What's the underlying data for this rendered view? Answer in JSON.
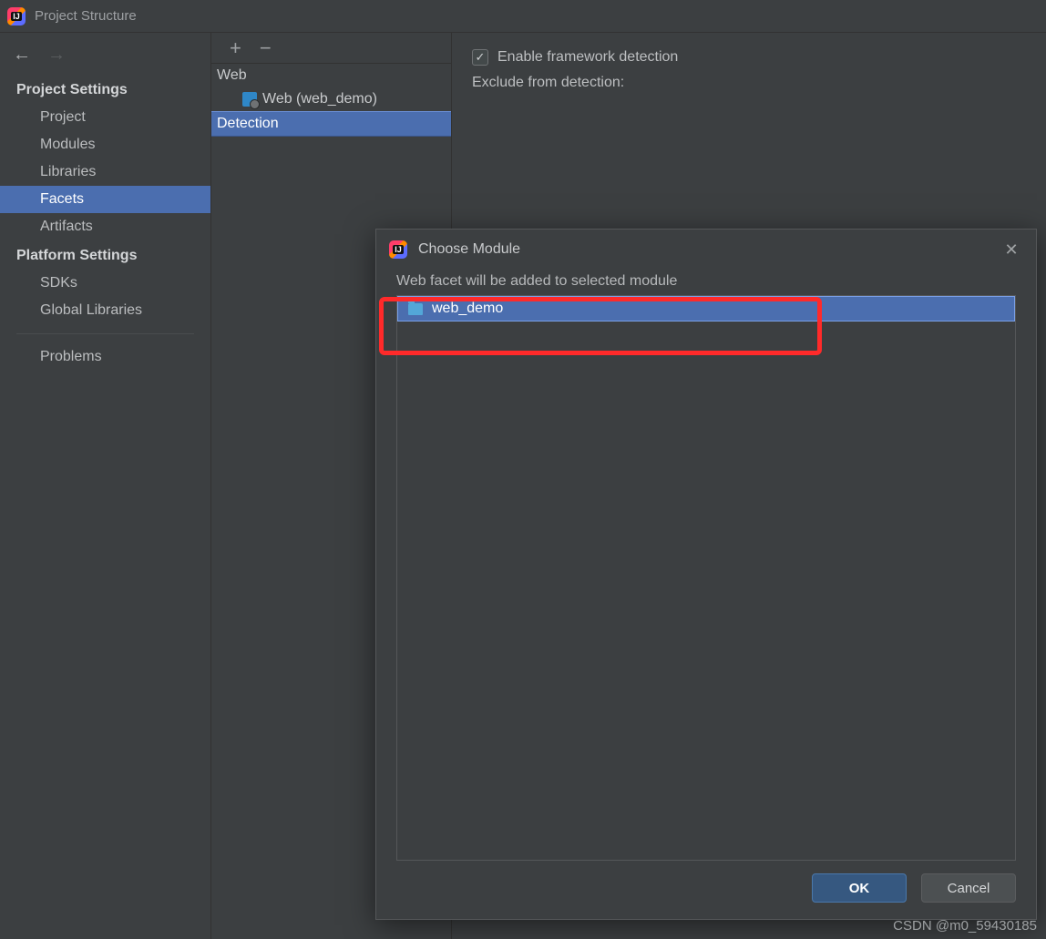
{
  "window": {
    "title": "Project Structure"
  },
  "sidebar": {
    "sections": {
      "project": {
        "title": "Project Settings",
        "items": [
          "Project",
          "Modules",
          "Libraries",
          "Facets",
          "Artifacts"
        ],
        "selected": "Facets"
      },
      "platform": {
        "title": "Platform Settings",
        "items": [
          "SDKs",
          "Global Libraries"
        ]
      },
      "problems": {
        "label": "Problems"
      }
    }
  },
  "tree": {
    "root": "Web",
    "child": "Web (web_demo)",
    "detection": "Detection"
  },
  "detail": {
    "enable_detection": "Enable framework detection",
    "exclude_label": "Exclude from detection:"
  },
  "dialog": {
    "title": "Choose Module",
    "subtitle": "Web facet will be added to selected module",
    "module": "web_demo",
    "ok": "OK",
    "cancel": "Cancel"
  },
  "watermark": "CSDN @m0_59430185"
}
